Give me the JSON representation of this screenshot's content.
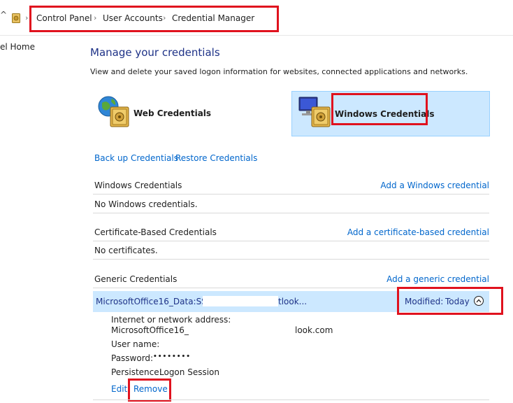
{
  "breadcrumb": {
    "items": [
      "Control Panel",
      "User Accounts",
      "Credential Manager"
    ],
    "separator": "›",
    "back_glyph": "^"
  },
  "sidebar": {
    "home_link": "el Home"
  },
  "main": {
    "title": "Manage your credentials",
    "description": "View and delete your saved logon information for websites, connected applications and networks.",
    "tiles": {
      "web": "Web Credentials",
      "windows": "Windows Credentials"
    },
    "backup_link": "Back up Credentials",
    "restore_link": "Restore Credentials",
    "sections": {
      "windows": {
        "title": "Windows Credentials",
        "add_link": "Add a Windows credential",
        "empty_text": "No Windows credentials."
      },
      "certificate": {
        "title": "Certificate-Based Credentials",
        "add_link": "Add a certificate-based credential",
        "empty_text": "No certificates."
      },
      "generic": {
        "title": "Generic Credentials",
        "add_link": "Add a generic credential",
        "entry": {
          "name_prefix": "MicrosoftOffice16_Data:SSPI:",
          "name_suffix": "tlook...",
          "modified_label": "Modified:",
          "modified_value": "Today",
          "address_label": "Internet or network address:",
          "address_prefix": "MicrosoftOffice16_",
          "address_suffix": "look.com",
          "username_label": "User name:",
          "password_label": "Password:",
          "password_value": "••••••••",
          "persistence_label": "Persistence:",
          "persistence_value": "Logon Session",
          "edit_link": "Edit",
          "remove_link": "Remove"
        }
      }
    }
  },
  "colors": {
    "link": "#0066cc",
    "highlight_border": "#e0121e",
    "selected_tile": "#cce8ff",
    "selected_row": "#cce8ff"
  },
  "icons": [
    "up-arrow-icon",
    "control-panel-icon",
    "globe-safe-icon",
    "monitor-safe-icon",
    "chevron-up-icon"
  ]
}
